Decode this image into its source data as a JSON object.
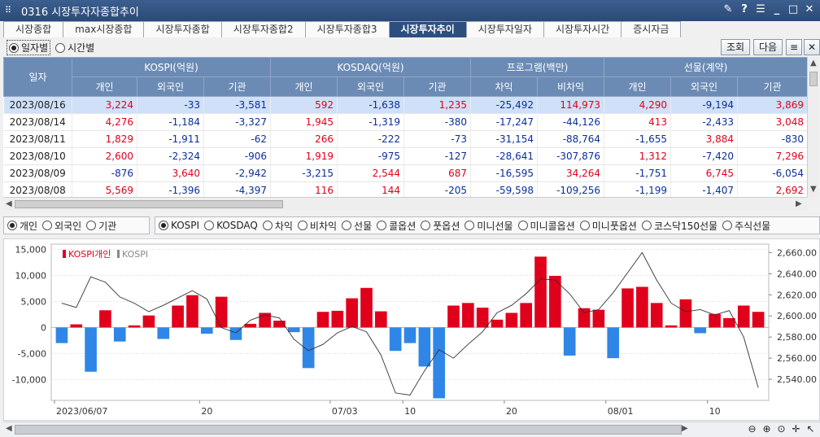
{
  "window": {
    "title": "0316 시장투자자종합추이"
  },
  "tabs": [
    "시장종합",
    "max시장종합",
    "시장투자종합",
    "시장투자종합2",
    "시장투자종합3",
    "시장투자추이",
    "시장투자일자",
    "시장투자시간",
    "증시자금"
  ],
  "active_tab": 5,
  "period_options": [
    "일자별",
    "시간별"
  ],
  "buttons": {
    "query": "조회",
    "next": "다음"
  },
  "table": {
    "date_header": "일자",
    "groups": [
      "KOSPI(억원)",
      "KOSDAQ(억원)",
      "프로그램(백만)",
      "선물(계약)"
    ],
    "subheaders": [
      "개인",
      "외국인",
      "기관",
      "개인",
      "외국인",
      "기관",
      "차익",
      "비차익",
      "개인",
      "외국인",
      "기관"
    ],
    "rows": [
      [
        "2023/08/16",
        "3,224",
        "-33",
        "-3,581",
        "592",
        "-1,638",
        "1,235",
        "-25,492",
        "114,973",
        "4,290",
        "-9,194",
        "3,869"
      ],
      [
        "2023/08/14",
        "4,276",
        "-1,184",
        "-3,327",
        "1,945",
        "-1,319",
        "-380",
        "-17,247",
        "-44,126",
        "413",
        "-2,433",
        "3,048"
      ],
      [
        "2023/08/11",
        "1,829",
        "-1,911",
        "-62",
        "266",
        "-222",
        "-73",
        "-31,154",
        "-88,764",
        "-1,655",
        "3,884",
        "-830"
      ],
      [
        "2023/08/10",
        "2,600",
        "-2,324",
        "-906",
        "1,919",
        "-975",
        "-127",
        "-28,641",
        "-307,876",
        "1,312",
        "-7,420",
        "7,296"
      ],
      [
        "2023/08/09",
        "-876",
        "3,640",
        "-2,942",
        "-3,215",
        "2,544",
        "687",
        "-16,595",
        "34,264",
        "-1,751",
        "6,745",
        "-6,054"
      ],
      [
        "2023/08/08",
        "5,569",
        "-1,396",
        "-4,397",
        "116",
        "144",
        "-205",
        "-59,598",
        "-109,256",
        "-1,199",
        "-1,407",
        "2,692"
      ]
    ]
  },
  "investor_options": [
    "개인",
    "외국인",
    "기관"
  ],
  "market_options": [
    "KOSPI",
    "KOSDAQ",
    "차익",
    "비차익",
    "선물",
    "콜옵션",
    "풋옵션",
    "미니선물",
    "미니콜옵션",
    "미니풋옵션",
    "코스닥150선물",
    "주식선물"
  ],
  "colors": {
    "positive": "#e0001b",
    "negative": "#2f86e6",
    "line": "#333333",
    "header": "#6b8bb5",
    "active_tab": "#2d4f7f"
  },
  "chart_data": {
    "type": "bar",
    "legend": [
      "KOSPI개인",
      "KOSPI"
    ],
    "x_ticks": [
      "2023/06/07",
      "20",
      "07/03",
      "10",
      "20",
      "08/01",
      "10"
    ],
    "y_left_ticks": [
      "15,000",
      "10,000",
      "5,000",
      "0",
      "-5,000",
      "-10,000"
    ],
    "y_right_ticks": [
      "2,660.00",
      "2,640.00",
      "2,620.00",
      "2,600.00",
      "2,580.00",
      "2,560.00",
      "2,540.00"
    ],
    "ylim_left": [
      -14000,
      16000
    ],
    "ylim_right": [
      2520,
      2668
    ],
    "bars": [
      -3000,
      600,
      -8500,
      3300,
      -2700,
      400,
      2300,
      -2200,
      4200,
      6200,
      -1200,
      5900,
      -2400,
      700,
      2800,
      1300,
      -900,
      -7800,
      3000,
      3200,
      5600,
      7600,
      3100,
      -4500,
      -3000,
      -7500,
      -13600,
      4200,
      4700,
      3800,
      1500,
      2800,
      4700,
      13600,
      9900,
      -5400,
      3700,
      3400,
      -5900,
      7500,
      7800,
      4700,
      400,
      5400,
      -1100,
      2600,
      1800,
      4200,
      3000
    ],
    "line": [
      2612,
      2608,
      2637,
      2632,
      2618,
      2612,
      2604,
      2610,
      2617,
      2624,
      2616,
      2589,
      2584,
      2596,
      2601,
      2598,
      2578,
      2567,
      2573,
      2584,
      2590,
      2585,
      2563,
      2527,
      2525,
      2548,
      2568,
      2560,
      2573,
      2585,
      2603,
      2610,
      2621,
      2635,
      2634,
      2621,
      2603,
      2606,
      2622,
      2641,
      2660,
      2634,
      2612,
      2604,
      2606,
      2601,
      2605,
      2580,
      2532
    ]
  }
}
